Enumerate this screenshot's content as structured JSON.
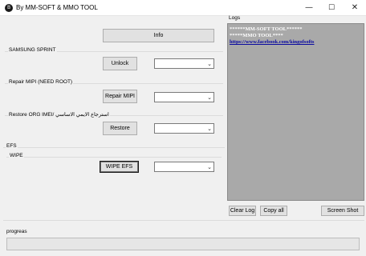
{
  "window": {
    "title": "By MM-SOFT & MMO TOOL",
    "icon_glyph": "B",
    "minimize_glyph": "—",
    "maximize_glyph": "☐",
    "close_glyph": "✕"
  },
  "buttons": {
    "info": "Info",
    "unlock": "Unlock",
    "repair_mipi": "Repair MIPI",
    "restore": "Restore",
    "wipe_efs": "WIPE EFS",
    "clear_log": "Clear Log",
    "copy_all": "Copy all",
    "screen_shot": "Screen Shot"
  },
  "groups": {
    "samsung_sprint": "SAMSUNG SPRINT",
    "repair_mipi": "Repair MIPI (NEED ROOT)",
    "restore_org": "Restore ORG IMEI/ استرجاع الايمي الاساسي",
    "efs": "EFS",
    "wipe": "WIPE",
    "logs": "Logs",
    "progress": "progreas"
  },
  "log": {
    "lines": [
      "******MM-SOFT TOOL******",
      "*****MMO TOOL****"
    ],
    "link": "https://www.facebook.com/kingofsofts"
  },
  "combo_arrow": "⌄",
  "progress_value": 0
}
